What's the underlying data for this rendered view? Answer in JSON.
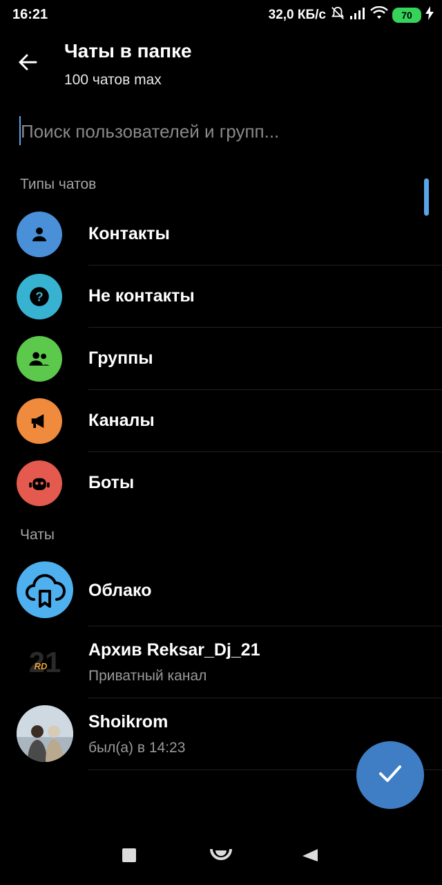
{
  "status_bar": {
    "time": "16:21",
    "network_speed": "32,0 КБ/с",
    "battery_level": "70",
    "icons": [
      "bell-off-icon",
      "signal-icon",
      "wifi-icon",
      "battery-icon",
      "charging-icon"
    ]
  },
  "app_bar": {
    "title": "Чаты в папке",
    "subtitle": "100 чатов max",
    "back_icon": "arrow-left-icon"
  },
  "search": {
    "value": "",
    "placeholder": "Поиск пользователей и групп..."
  },
  "chat_types": {
    "header": "Типы чатов",
    "items": [
      {
        "label": "Контакты",
        "icon": "person-icon",
        "color": "#4a90d9"
      },
      {
        "label": "Не контакты",
        "icon": "question-icon",
        "color": "#37b3d1"
      },
      {
        "label": "Группы",
        "icon": "group-icon",
        "color": "#5cc84c"
      },
      {
        "label": "Каналы",
        "icon": "megaphone-icon",
        "color": "#f08a3c"
      },
      {
        "label": "Боты",
        "icon": "bot-icon",
        "color": "#e55a4e"
      }
    ]
  },
  "chats": {
    "header": "Чаты",
    "items": [
      {
        "title": "Облако",
        "subtitle": "",
        "icon": "cloud-bookmark-icon",
        "color": "#4fb0ef"
      },
      {
        "title": "Архив Reksar_Dj_21",
        "subtitle": "Приватный канал",
        "icon": "logo-21-rd",
        "color": "#000000"
      },
      {
        "title": "Shoikrom",
        "subtitle": "был(а) в 14:23",
        "icon": "user-photo-avatar",
        "color": "#c7d3dc"
      }
    ]
  },
  "fab": {
    "icon": "check-icon",
    "color": "#3f7ec4"
  },
  "nav_bar": {
    "buttons": [
      "recents-square-icon",
      "home-circle-icon",
      "back-triangle-icon"
    ]
  }
}
